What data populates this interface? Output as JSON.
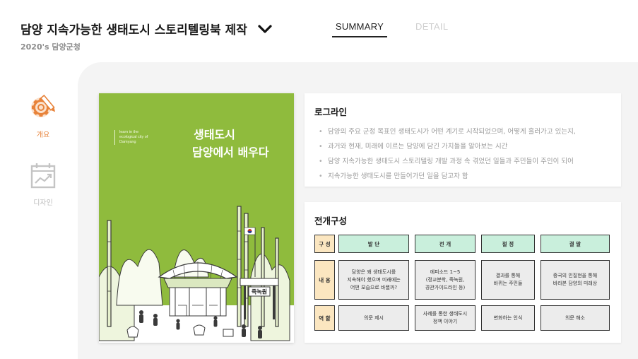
{
  "header": {
    "title": "담양 지속가능한 생태도시 스토리텔링북 제작",
    "subtitle": "2020's 담양군청"
  },
  "tabs": [
    {
      "label": "SUMMARY",
      "active": true
    },
    {
      "label": "DETAIL",
      "active": false
    }
  ],
  "nav": {
    "overview": {
      "label": "개요",
      "icon": "gear-pencil-icon",
      "active": true
    },
    "design": {
      "label": "디자인",
      "icon": "calendar-chart-icon",
      "active": false
    }
  },
  "cover": {
    "tag_lines": [
      "learn in the",
      "ecological city of",
      "Damyang"
    ],
    "title_line1": "생태도시",
    "title_line2": "담양에서 배우다",
    "sign": "죽녹원",
    "bg_color": "#8fbb3d"
  },
  "logline": {
    "heading": "로그라인",
    "items": [
      "담양의 주요 군정 목표인 생태도시가 어떤 계기로 시작되었으며, 어떻게 흘러가고 있는지,",
      "과거와 현재, 미래에 이르는 담양에 담긴 가치들을 알아보는 시간",
      "담양 지속가능한 생태도시 스토리텔링 개발 과정 속 겪었던 일들과 주민들이 주인이 되어",
      "지속가능한 생태도시를 만들어가던 일을 담고자 함"
    ]
  },
  "structure": {
    "heading": "전개구성",
    "row_heads": [
      "구 성",
      "내 용",
      "역 할"
    ],
    "columns": [
      "발 단",
      "전 개",
      "절 정",
      "결 말"
    ],
    "contents": [
      [
        "담양은 왜 생태도시를",
        "지속해야 했으며 미래에는",
        "어떤 모습으로 바뀔까?"
      ],
      [
        "에피소드 1~5",
        "(정교분학, 죽녹원,",
        "경관가이드라인 등)"
      ],
      [
        "결과를 통해",
        "바뀌는 주민들"
      ],
      [
        "중국의 인질현을 통해",
        "바라본 담양의 미래상"
      ]
    ],
    "roles": [
      [
        "의문 제시"
      ],
      [
        "사례를 통한 생태도시",
        "정책 이야기"
      ],
      [
        "변화하는 인식"
      ],
      [
        "의문 해소"
      ]
    ],
    "colors": {
      "row_head": "#fbe6c0",
      "col_head": "#c9efdc",
      "body": "#ececec"
    }
  },
  "colors": {
    "accent": "#e8833a",
    "inactive": "#bdbdbd"
  }
}
